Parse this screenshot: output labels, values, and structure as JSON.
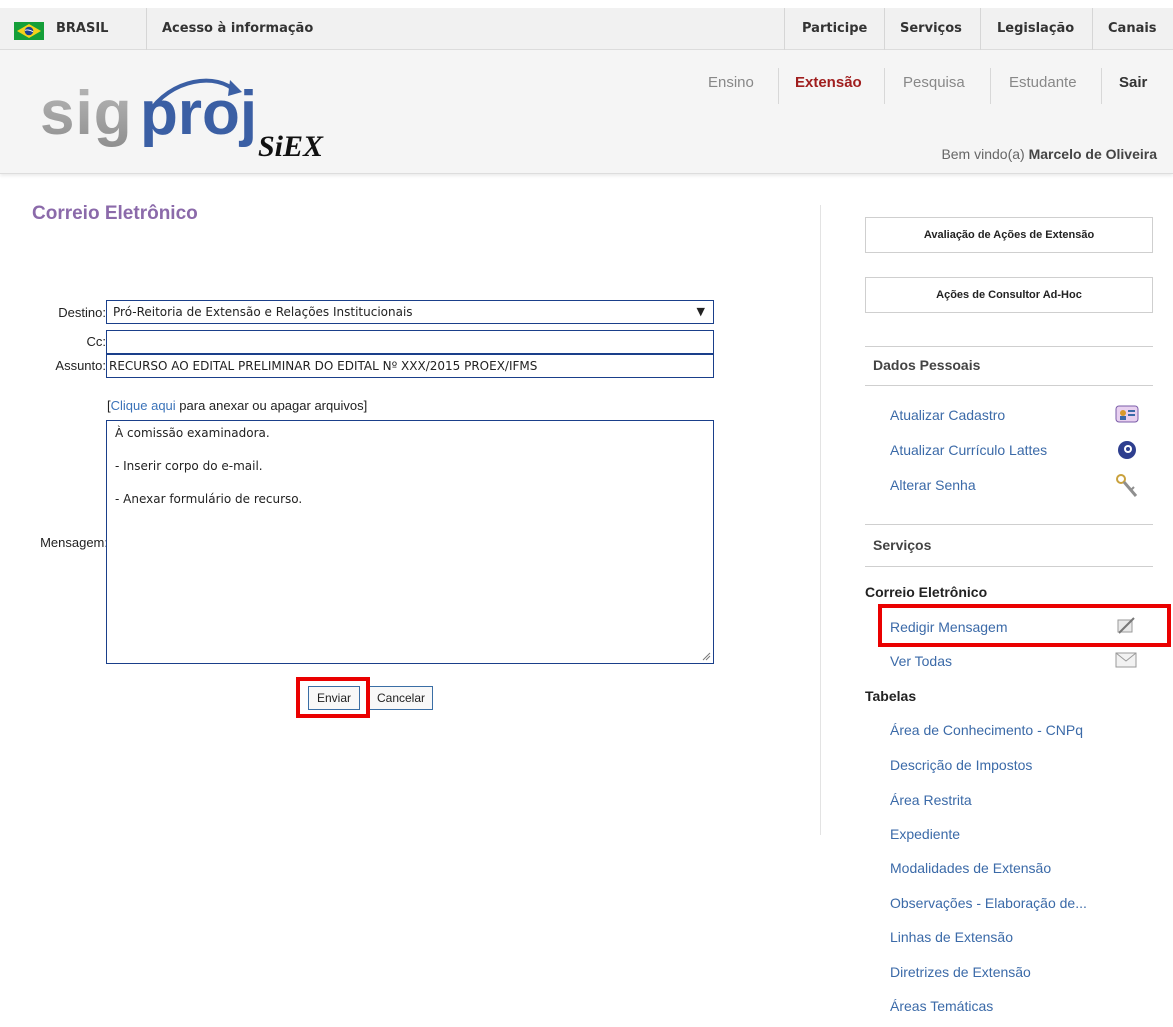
{
  "govbar": {
    "country": "BRASIL",
    "access": "Acesso à informação",
    "links": [
      "Participe",
      "Serviços",
      "Legislação",
      "Canais"
    ]
  },
  "header": {
    "logo_text": "sigproj",
    "logo_sub": "SIEX",
    "nav": [
      "Ensino",
      "Extensão",
      "Pesquisa",
      "Estudante",
      "Sair"
    ],
    "welcome_prefix": "Bem vindo(a)",
    "user_name": "Marcelo de Oliveira"
  },
  "page": {
    "title": "Correio Eletrônico"
  },
  "form": {
    "destino_label": "Destino:",
    "destino_value": "Pró-Reitoria de Extensão e Relações Institucionais",
    "cc_label": "Cc:",
    "cc_value": "",
    "assunto_label": "Assunto:",
    "assunto_value": "RECURSO AO EDITAL PRELIMINAR DO EDITAL Nº XXX/2015 PROEX/IFMS",
    "attach_open": "[",
    "attach_link": "Clique aqui",
    "attach_rest": " para anexar ou apagar arquivos]",
    "mensagem_label": "Mensagem:",
    "message_lines": [
      "À comissão examinadora.",
      "- Inserir corpo do e-mail.",
      "- Anexar formulário de recurso."
    ],
    "send": "Enviar",
    "cancel": "Cancelar"
  },
  "sidebar": {
    "btn_avaliacao": "Avaliação de Ações de Extensão",
    "btn_consultor": "Ações de Consultor Ad-Hoc",
    "dados_pessoais": "Dados Pessoais",
    "dados_links": [
      "Atualizar Cadastro",
      "Atualizar Currículo Lattes",
      "Alterar Senha"
    ],
    "servicos": "Serviços",
    "correio": "Correio Eletrônico",
    "correio_links": [
      "Redigir Mensagem",
      "Ver Todas"
    ],
    "tabelas": "Tabelas",
    "tabelas_links": [
      "Área de Conhecimento - CNPq",
      "Descrição de Impostos",
      "Área Restrita",
      "Expediente",
      "Modalidades de Extensão",
      "Observações - Elaboração de...",
      "Linhas de Extensão",
      "Diretrizes de Extensão",
      "Áreas Temáticas"
    ]
  },
  "colors": {
    "accent_red": "#a01e1e",
    "title_purple": "#8b6aaa",
    "link_blue": "#3b6aa8",
    "highlight_red": "#ea0000"
  }
}
